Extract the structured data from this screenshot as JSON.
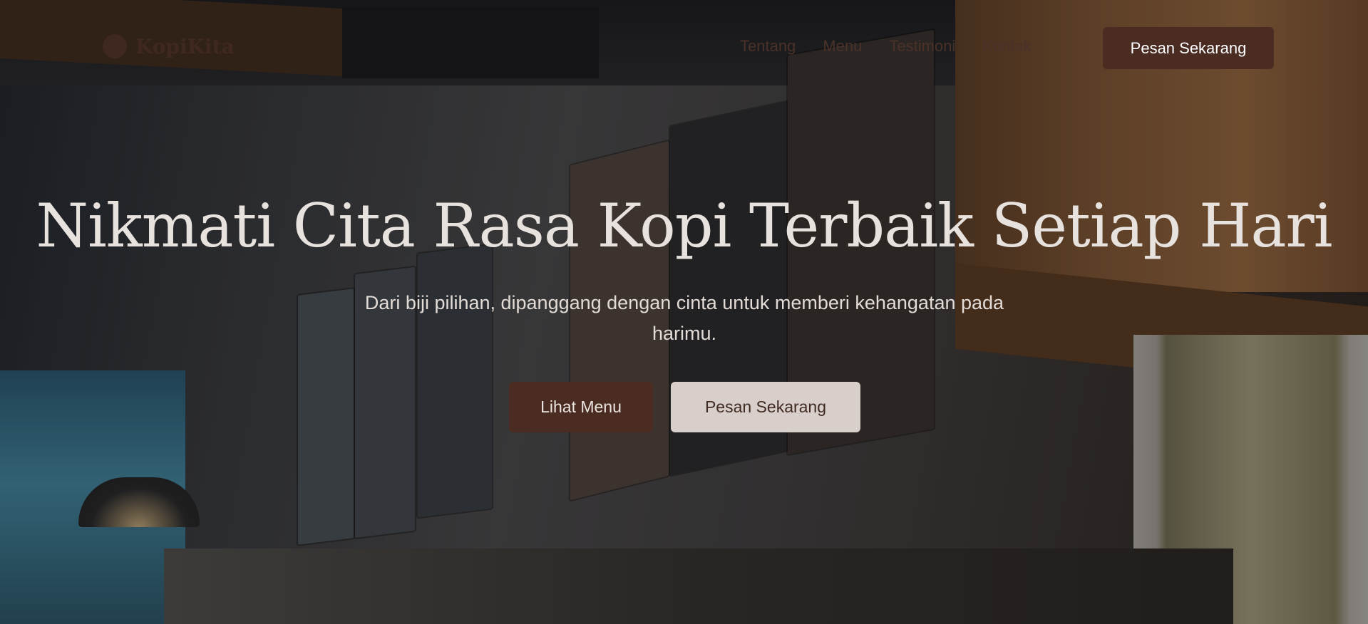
{
  "navbar": {
    "brand_name": "KopiKita",
    "links": [
      "Tentang",
      "Menu",
      "Testimoni",
      "Kontak"
    ],
    "cta_label": "Pesan Sekarang"
  },
  "hero": {
    "title": "Nikmati Cita Rasa Kopi Terbaik Setiap Hari",
    "subtitle": "Dari biji pilihan, dipanggang dengan cinta untuk memberi kehangatan pada harimu.",
    "primary_button": "Lihat Menu",
    "secondary_button": "Pesan Sekarang"
  },
  "colors": {
    "accent": "#4a2c23",
    "secondary_button_bg": "#d8cfca",
    "overlay": "rgba(20,14,10,0.45)"
  },
  "icons": {
    "brand": "coffee-logo-icon"
  }
}
